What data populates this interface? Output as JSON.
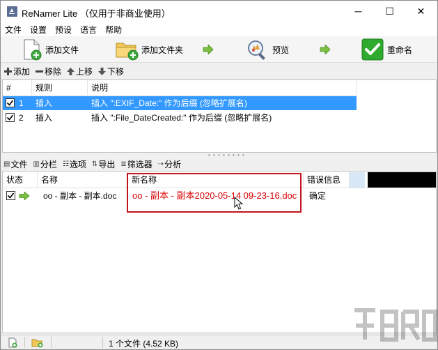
{
  "window": {
    "title": "ReNamer Lite （仅用于非商业使用）",
    "min_glyph": "─",
    "max_glyph": "☐",
    "close_glyph": "✕"
  },
  "menu": [
    "文件",
    "设置",
    "预设",
    "语言",
    "帮助"
  ],
  "toolbar": {
    "add_files": "添加文件",
    "add_folder": "添加文件夹",
    "preview": "预览",
    "rename": "重命名"
  },
  "rules_toolbar": {
    "add": "添加",
    "remove": "移除",
    "up": "上移",
    "down": "下移"
  },
  "rules_table": {
    "headers": [
      "#",
      "规则",
      "说明"
    ],
    "rows": [
      {
        "num": "1",
        "rule": "插入",
        "desc": "插入 \":EXIF_Date:\" 作为后缀 (忽略扩展名)",
        "checked": true,
        "selected": true
      },
      {
        "num": "2",
        "rule": "插入",
        "desc": "插入 \":File_DateCreated:\" 作为后缀 (忽略扩展名)",
        "checked": true,
        "selected": false
      }
    ]
  },
  "files_toolbar": {
    "files": "文件",
    "columns": "分栏",
    "options": "选项",
    "export": "导出",
    "filter": "筛选器",
    "analyze": "分析"
  },
  "files_table": {
    "headers": [
      "状态",
      "名称",
      "新名称",
      "错误信息"
    ],
    "rows": [
      {
        "name": "oo - 副本 - 副本.doc",
        "new_name": "oo - 副本 - 副本2020-05-14 09-23-16.doc",
        "error": "确定",
        "checked": true
      }
    ]
  },
  "statusbar": {
    "text": "1 个文件 (4.52 KB)"
  },
  "colors": {
    "selection": "#3399ff",
    "new_name": "#d80000",
    "highlight_box": "#c0151b",
    "rename_green": "#2eaa2e"
  }
}
